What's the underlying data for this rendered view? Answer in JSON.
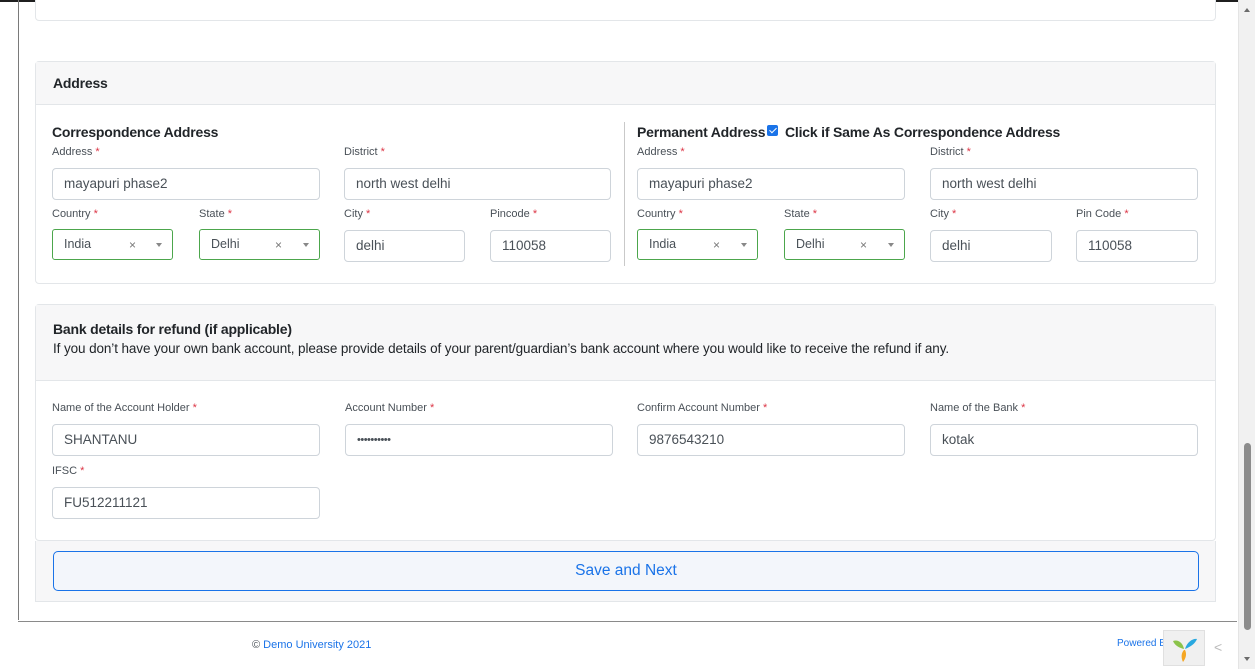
{
  "address_section": {
    "title": "Address",
    "correspondence": {
      "title": "Correspondence Address",
      "address_label": "Address",
      "address_value": "mayapuri phase2",
      "district_label": "District",
      "district_value": "north west delhi",
      "country_label": "Country",
      "country_value": "India",
      "state_label": "State",
      "state_value": "Delhi",
      "city_label": "City",
      "city_value": "delhi",
      "pincode_label": "Pincode",
      "pincode_value": "110058"
    },
    "permanent": {
      "title": "Permanent Address",
      "same_checkbox_label": "Click if Same As Correspondence Address",
      "same_checked": true,
      "address_label": "Address",
      "address_value": "mayapuri phase2",
      "district_label": "District",
      "district_value": "north west delhi",
      "country_label": "Country",
      "country_value": "India",
      "state_label": "State",
      "state_value": "Delhi",
      "city_label": "City",
      "city_value": "delhi",
      "pincode_label": "Pin Code",
      "pincode_value": "110058"
    }
  },
  "bank_section": {
    "title": "Bank details for refund (if applicable)",
    "description": "If you don’t have your own bank account, please provide details of your parent/guardian’s bank account where you would like to receive the refund if any.",
    "holder_label": "Name of the Account Holder",
    "holder_value": "SHANTANU",
    "account_label": "Account Number",
    "account_value": "••••••••••",
    "confirm_label": "Confirm Account Number",
    "confirm_value": "9876543210",
    "bank_label": "Name of the Bank",
    "bank_value": "kotak",
    "ifsc_label": "IFSC",
    "ifsc_value": "FU512211121"
  },
  "required_mark": "*",
  "clear_glyph": "×",
  "save_button": "Save and Next",
  "footer": {
    "copyright_symbol": "©",
    "copyright_link": "Demo University 2021",
    "powered_by": "Powered By:",
    "back_glyph": "<"
  },
  "colors": {
    "accent": "#1a73e8",
    "required": "#dc3545",
    "select_border": "#4ca64c"
  }
}
